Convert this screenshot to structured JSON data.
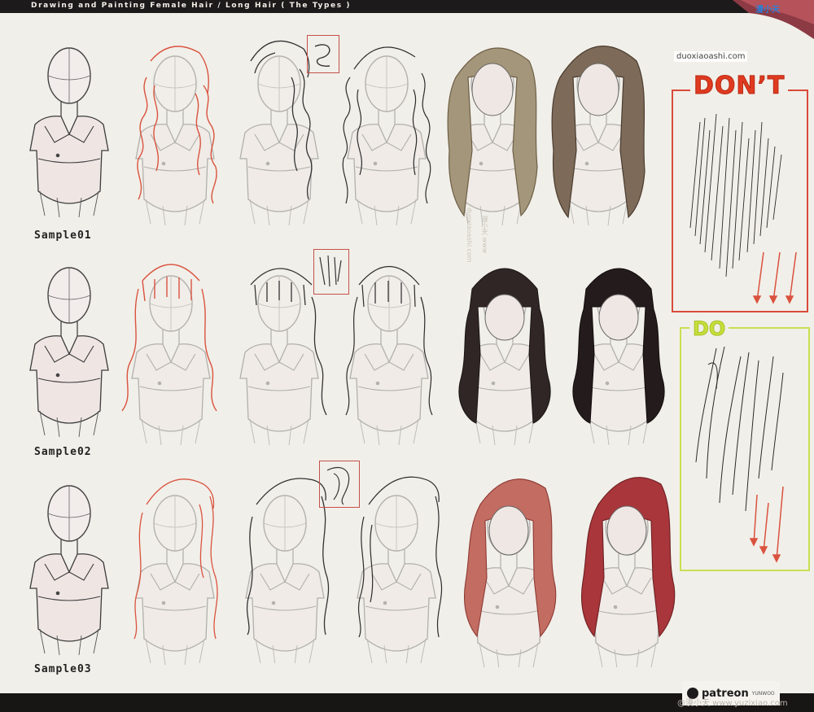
{
  "header": {
    "title": "Drawing and Painting Female Hair / Long Hair ( The Types )"
  },
  "watermark": {
    "site_top": "漫小天",
    "site_url": "duoxiaoashi.com",
    "footer_url": "@漫小天 www.yuzixiao.com"
  },
  "samples": [
    {
      "label": "Sample01"
    },
    {
      "label": "Sample02"
    },
    {
      "label": "Sample03"
    }
  ],
  "panels": {
    "dont_label": "DON’T",
    "do_label": "DO"
  },
  "brand": {
    "name": "patreon",
    "sub": "YUNWOO"
  },
  "colors": {
    "sketch_red": "#d9533f",
    "sample1_hair": "#8a7a5c",
    "sample2_hair": "#2d2423",
    "sample3_hair": "#b24c44",
    "dont_border": "#d94b3a",
    "do_border": "#c8e052"
  }
}
